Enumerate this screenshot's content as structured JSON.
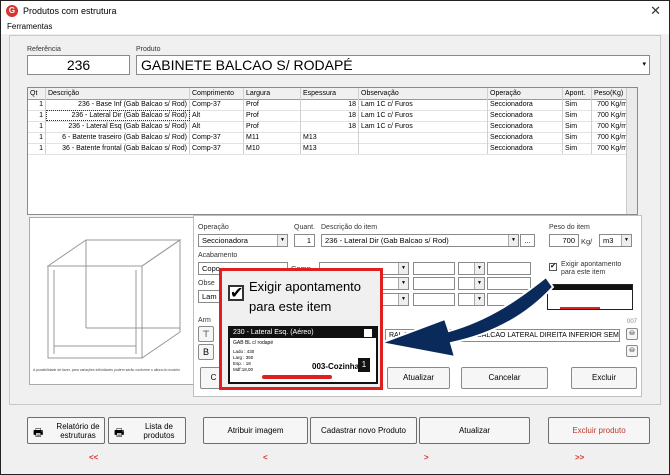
{
  "window": {
    "title": "Produtos com estrutura",
    "app_icon": "G",
    "close": "✕"
  },
  "menu": {
    "ferramentas": "Ferramentas"
  },
  "product": {
    "ref_label": "Referência",
    "ref_value": "236",
    "prod_label": "Produto",
    "prod_value": "GABINETE BALCAO S/ RODAPÉ"
  },
  "grid": {
    "headers": [
      "Qt",
      "Descrição",
      "Comprimento",
      "Largura",
      "Espessura",
      "Observação",
      "Operação",
      "Apont.",
      "Peso(Kg)"
    ],
    "rows": [
      [
        "1",
        "236 - Base Inf (Gab Balcao s/ Rod)",
        "Comp-37",
        "Prof",
        "18",
        "Lam 1C c/ Furos",
        "Seccionadora",
        "Sim",
        "700 Kg/m3"
      ],
      [
        "1",
        "236 - Lateral Dir (Gab Balcao s/ Rod)",
        "Alt",
        "Prof",
        "18",
        "Lam 1C c/ Furos",
        "Seccionadora",
        "Sim",
        "700 Kg/m3"
      ],
      [
        "1",
        "236 - Lateral Esq (Gab Balcao s/ Rod)",
        "Alt",
        "Prof",
        "18",
        "Lam 1C c/ Furos",
        "Seccionadora",
        "Sim",
        "700 Kg/m3"
      ],
      [
        "1",
        "6 - Batente traseiro (Gab Balcao s/ Rod)",
        "Comp-37",
        "M11",
        "M13",
        "",
        "Seccionadora",
        "Sim",
        "700 Kg/m3"
      ],
      [
        "1",
        "36 - Batente frontal (Gab Balcao s/ Rod)",
        "Comp-37",
        "M10",
        "M13",
        "",
        "Seccionadora",
        "Sim",
        "700 Kg/m3"
      ]
    ]
  },
  "drawing": {
    "caption": "A possibilidade de fazer, para variações infinidáveis podem serão conforme o altura do modelo"
  },
  "detail": {
    "operacao_label": "Operação",
    "operacao_value": "Seccionadora",
    "quant_label": "Quant.",
    "quant_value": "1",
    "desc_label": "Descrição do item",
    "desc_value": "236 - Lateral Dir (Gab Balcao s/ Rod)",
    "peso_label": "Peso do item",
    "peso_value": "700",
    "peso_unit1": "Kg/",
    "peso_unit2": "m3",
    "acabamento_label": "Acabamento",
    "acab_value": "Copo",
    "comp_label": "Comp",
    "obs_label": "Obse",
    "obs_value": "Lam",
    "arm_label": "Arm",
    "checkbox_label": "Exigir apontamento para este item",
    "path_text": "RAL INFERIOR\\GABINETE BALCAO LATERAL DIREITA INFERIOR SEM RODAPE.GBS",
    "path_num": "007",
    "ellipsis": "...",
    "btn_atualizar": "Atualizar",
    "btn_cancelar": "Cancelar",
    "btn_excluir": "Excluir",
    "btn_c": "C"
  },
  "zoom": {
    "checkbox_label_line1": "Exigir apontamento",
    "checkbox_label_line2": "para este item",
    "label_title": "230 - Lateral Esq. (Aéreo)",
    "label_line2": "GAB BL c/ rodapé",
    "label_fields": [
      "Lado :   430",
      "Larg :    350",
      "Esp. :      18"
    ],
    "label_barcode_text": "Mdf:18,00",
    "label_code": "003-Cozinha",
    "label_count": "1"
  },
  "footer": {
    "btn_relatorio": "Relatório de estruturas",
    "btn_lista": "Lista de produtos",
    "btn_imagem": "Atribuir imagem",
    "btn_cadastrar": "Cadastrar novo Produto",
    "btn_atualizar": "Atualizar",
    "btn_excluir": "Excluir produto",
    "nav": [
      "<<",
      "<",
      ">",
      ">>"
    ]
  },
  "colors": {
    "accent_red": "#d9332b",
    "arrow_blue": "#0a2a5c"
  }
}
